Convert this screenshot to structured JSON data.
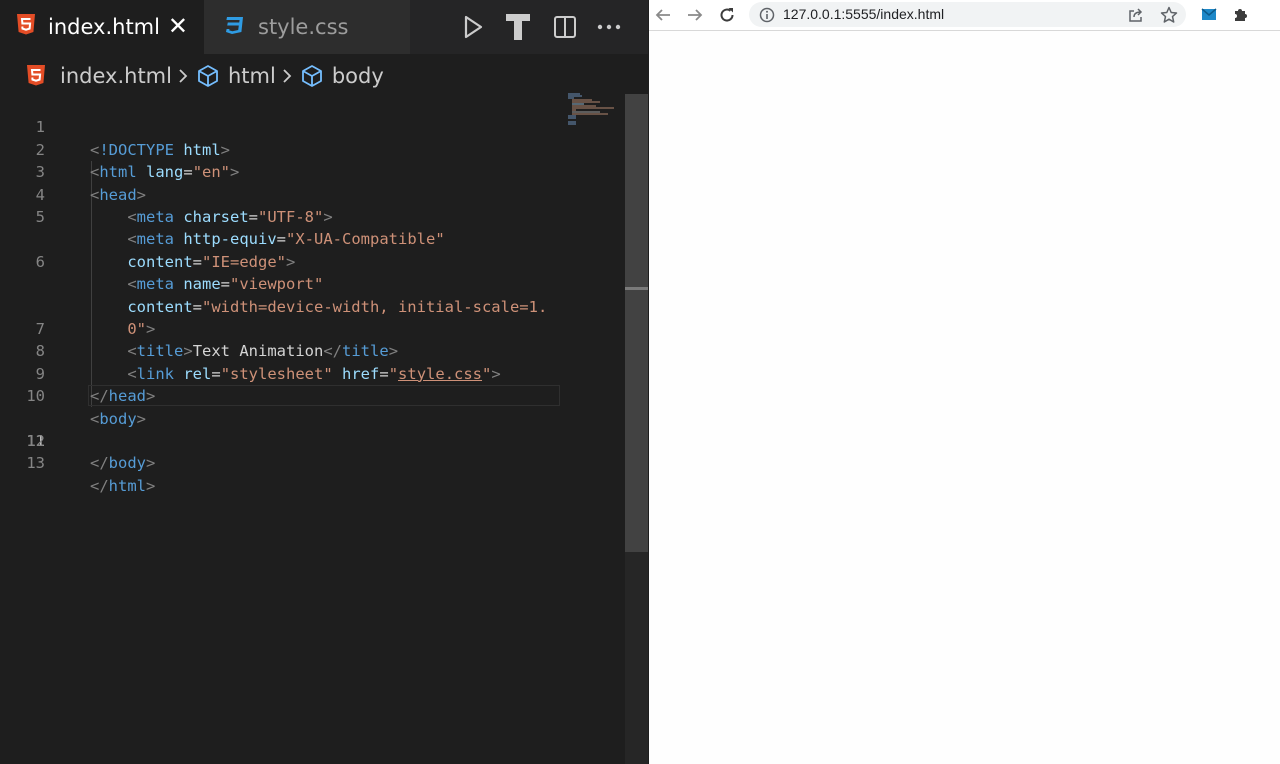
{
  "editor": {
    "tabs": [
      {
        "label": "index.html",
        "icon": "html5-icon",
        "active": true
      },
      {
        "label": "style.css",
        "icon": "css3-icon",
        "active": false
      }
    ],
    "breadcrumb": [
      "index.html",
      "html",
      "body"
    ],
    "line_numbers": [
      "1",
      "2",
      "3",
      "4",
      "5",
      "",
      "6",
      "",
      "",
      "7",
      "8",
      "9",
      "10",
      "11",
      "12",
      "13"
    ],
    "current_line": "11",
    "code": {
      "doctype": "!DOCTYPE",
      "doctype_html": "html",
      "html": "html",
      "lang_attr": "lang",
      "lang_val": "\"en\"",
      "head": "head",
      "meta": "meta",
      "charset_attr": "charset",
      "charset_val": "\"UTF-8\"",
      "http_equiv_attr": "http-equiv",
      "http_equiv_val": "\"X-UA-Compatible\"",
      "content_attr": "content",
      "content_val1": "\"IE=edge\"",
      "name_attr": "name",
      "name_val": "\"viewport\"",
      "content_val2a": "\"width=device-width, initial-scale=1.",
      "content_val2b": "0\"",
      "title": "title",
      "title_text": "Text Animation",
      "link": "link",
      "rel_attr": "rel",
      "rel_val": "\"stylesheet\"",
      "href_attr": "href",
      "href_q": "\"",
      "href_val": "style.css",
      "body": "body"
    },
    "colors": {
      "bg": "#1e1e1e",
      "tag": "#569cd6",
      "attr": "#9cdcfe",
      "string": "#ce9178",
      "html_icon": "#e44d26",
      "css_icon": "#2f9ce4"
    }
  },
  "browser": {
    "url": "127.0.0.1:5555/index.html",
    "toolbar_icons": [
      "back-arrow-icon",
      "forward-arrow-icon",
      "reload-icon",
      "site-info-icon",
      "share-icon",
      "bookmark-star-icon",
      "extension-icon",
      "puzzle-icon"
    ]
  }
}
